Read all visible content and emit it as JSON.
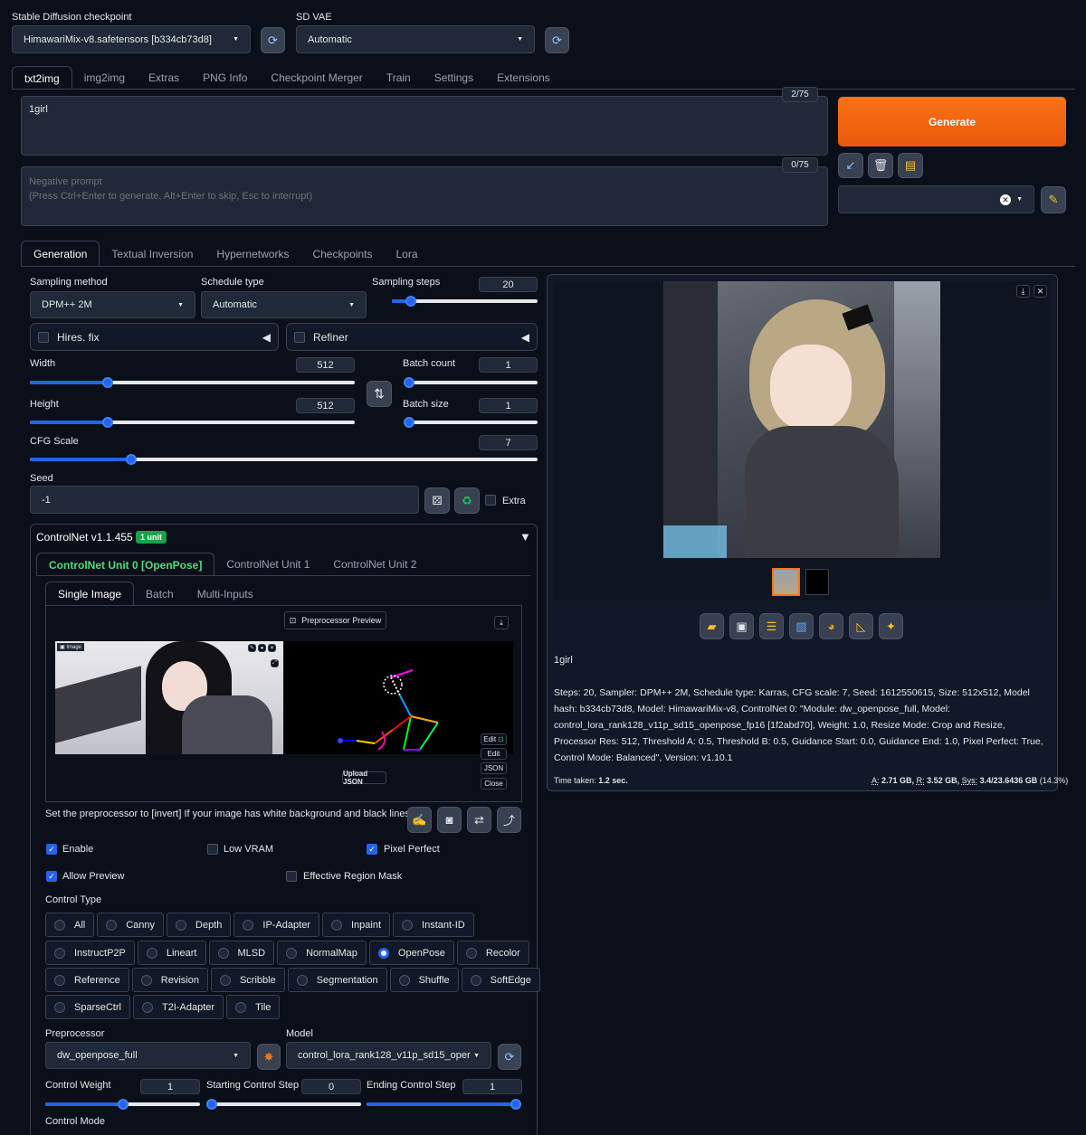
{
  "top": {
    "checkpoint_label": "Stable Diffusion checkpoint",
    "checkpoint_value": "HimawariMix-v8.safetensors [b334cb73d8]",
    "vae_label": "SD VAE",
    "vae_value": "Automatic"
  },
  "main_tabs": [
    "txt2img",
    "img2img",
    "Extras",
    "PNG Info",
    "Checkpoint Merger",
    "Train",
    "Settings",
    "Extensions"
  ],
  "prompt": {
    "value": "1girl",
    "counter": "2/75"
  },
  "negative": {
    "placeholder": "Negative prompt\n(Press Ctrl+Enter to generate, Alt+Enter to skip, Esc to interrupt)",
    "counter": "0/75"
  },
  "generate_label": "Generate",
  "sub_tabs": [
    "Generation",
    "Textual Inversion",
    "Hypernetworks",
    "Checkpoints",
    "Lora"
  ],
  "sampling": {
    "method_label": "Sampling method",
    "method_value": "DPM++ 2M",
    "schedule_label": "Schedule type",
    "schedule_value": "Automatic",
    "steps_label": "Sampling steps",
    "steps_value": "20",
    "steps_fraction": 0.13
  },
  "hires_label": "Hires. fix",
  "refiner_label": "Refiner",
  "width": {
    "label": "Width",
    "value": "512",
    "fraction": 0.24
  },
  "height": {
    "label": "Height",
    "value": "512",
    "fraction": 0.24
  },
  "batch_count": {
    "label": "Batch count",
    "value": "1",
    "fraction": 0.0
  },
  "batch_size": {
    "label": "Batch size",
    "value": "1",
    "fraction": 0.0
  },
  "cfg": {
    "label": "CFG Scale",
    "value": "7",
    "fraction": 0.2
  },
  "seed": {
    "label": "Seed",
    "value": "-1",
    "extra_label": "Extra"
  },
  "controlnet": {
    "title": "ControlNet v1.1.455",
    "badge": "1 unit",
    "unit_tabs": [
      "ControlNet Unit 0 [OpenPose]",
      "ControlNet Unit 1",
      "ControlNet Unit 2"
    ],
    "input_tabs": [
      "Single Image",
      "Batch",
      "Multi-Inputs"
    ],
    "preproc_preview": "Preprocessor Preview",
    "image_tag": "Image",
    "edit_buttons": [
      "Edit",
      "Edit",
      "JSON",
      "Close"
    ],
    "upload_json": "Upload JSON",
    "hint": "Set the preprocessor to [invert] If your image has white background and black lines.",
    "enable": "Enable",
    "low_vram": "Low VRAM",
    "pixel_perfect": "Pixel Perfect",
    "allow_preview": "Allow Preview",
    "effective_mask": "Effective Region Mask",
    "control_type_label": "Control Type",
    "types_row1": [
      "All",
      "Canny",
      "Depth",
      "IP-Adapter",
      "Inpaint",
      "Instant-ID"
    ],
    "types_row2": [
      "InstructP2P",
      "Lineart",
      "MLSD",
      "NormalMap",
      "OpenPose",
      "Recolor"
    ],
    "types_row3": [
      "Reference",
      "Revision",
      "Scribble",
      "Segmentation",
      "Shuffle",
      "SoftEdge"
    ],
    "types_row4": [
      "SparseCtrl",
      "T2I-Adapter",
      "Tile"
    ],
    "selected_type": "OpenPose",
    "preprocessor_label": "Preprocessor",
    "preprocessor_value": "dw_openpose_full",
    "model_label": "Model",
    "model_value": "control_lora_rank128_v11p_sd15_oper",
    "weight_label": "Control Weight",
    "weight_value": "1",
    "weight_fraction": 0.5,
    "start_label": "Starting Control Step",
    "start_value": "0",
    "start_fraction": 0.0,
    "end_label": "Ending Control Step",
    "end_value": "1",
    "end_fraction": 1.0,
    "mode_label": "Control Mode"
  },
  "output": {
    "prompt": "1girl",
    "params": "Steps: 20, Sampler: DPM++ 2M, Schedule type: Karras, CFG scale: 7, Seed: 1612550615, Size: 512x512, Model hash: b334cb73d8, Model: HimawariMix-v8, ControlNet 0: \"Module: dw_openpose_full, Model: control_lora_rank128_v11p_sd15_openpose_fp16 [1f2abd70], Weight: 1.0, Resize Mode: Crop and Resize, Processor Res: 512, Threshold A: 0.5, Threshold B: 0.5, Guidance Start: 0.0, Guidance End: 1.0, Pixel Perfect: True, Control Mode: Balanced\", Version: v1.10.1",
    "time_label": "Time taken:",
    "time_value": "1.2 sec.",
    "mem_a_label": "A:",
    "mem_a": "2.71 GB,",
    "mem_r_label": "R:",
    "mem_r": "3.52 GB,",
    "mem_sys_label": "Sys:",
    "mem_sys": "3.4/23.6436 GB",
    "mem_pct": "(14.3%)"
  },
  "colors": {
    "accent": "#2563eb",
    "generate": "#f97316",
    "badge": "#16a34a",
    "active_unit": "#4ade80"
  }
}
